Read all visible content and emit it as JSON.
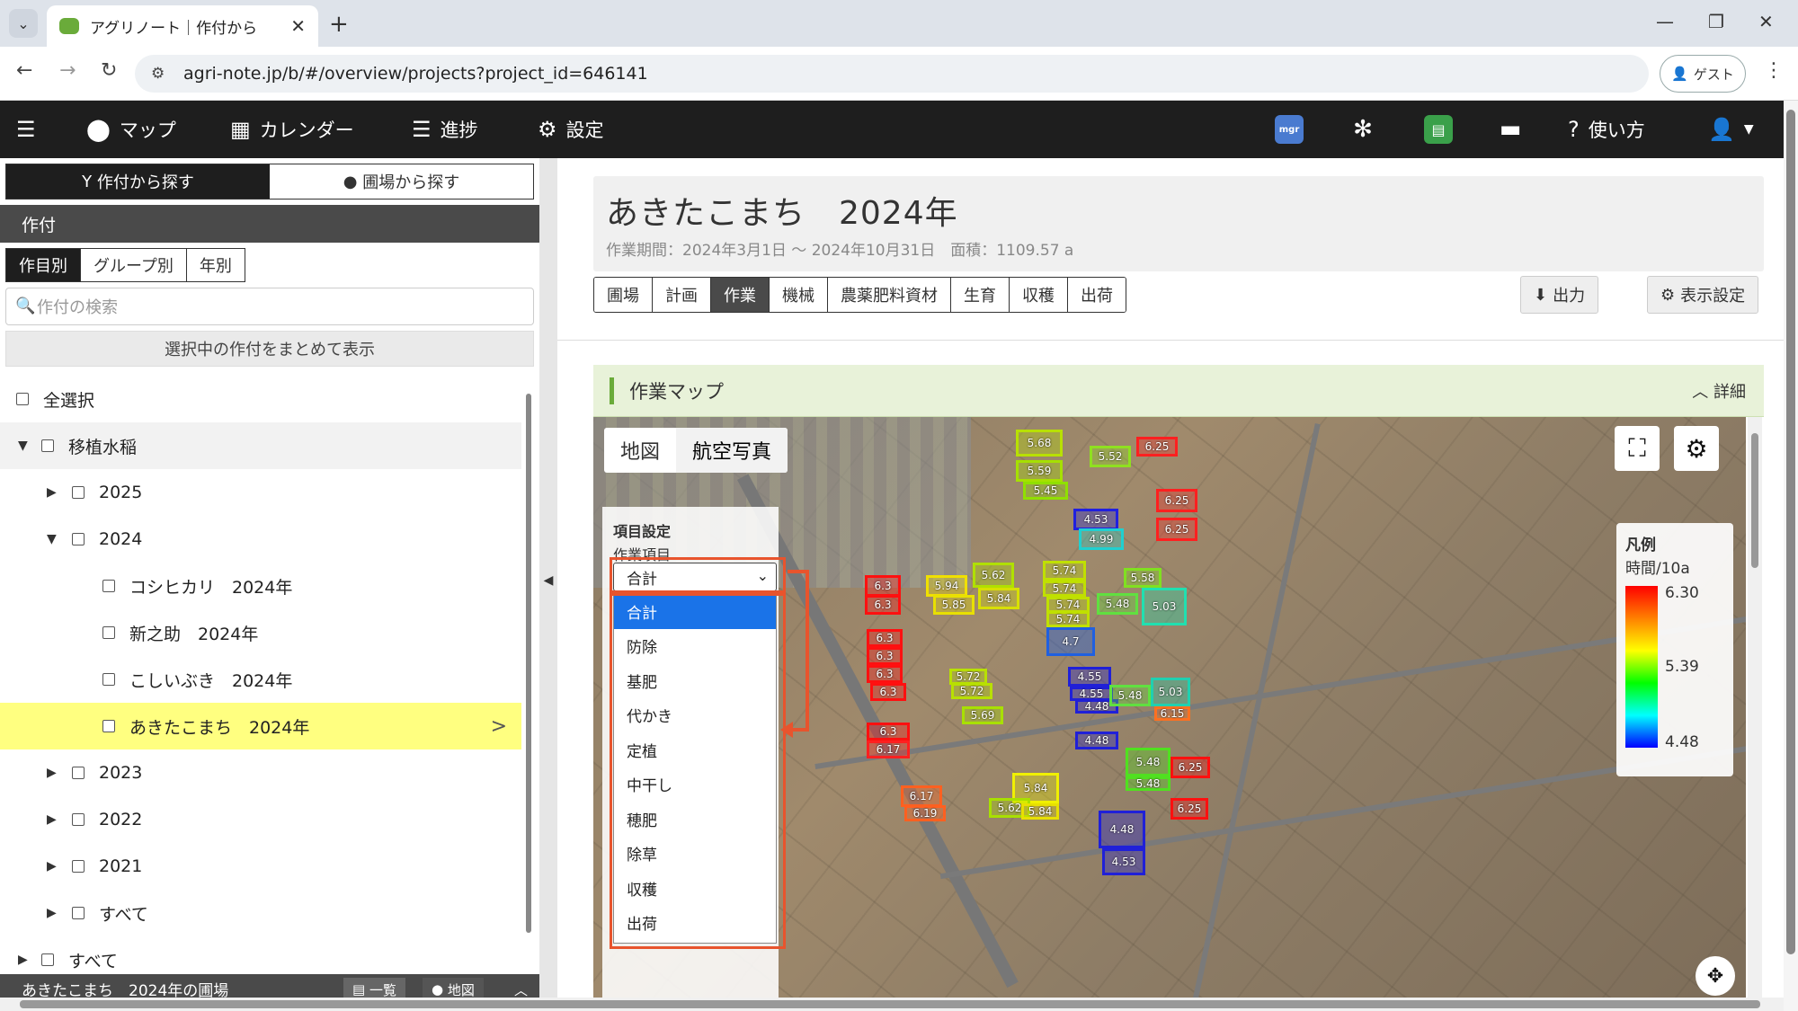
{
  "browser": {
    "tab_title": "アグリノート｜作付から",
    "url": "agri-note.jp/b/#/overview/projects?project_id=646141",
    "guest_label": "ゲスト"
  },
  "appbar": {
    "map": "マップ",
    "calendar": "カレンダー",
    "progress": "進捗",
    "settings": "設定",
    "help": "使い方",
    "mgr_badge": "mgr"
  },
  "left": {
    "tab_crop": "作付から探す",
    "tab_field": "圃場から探す",
    "section": "作付",
    "filter_item": "作目別",
    "filter_group": "グループ別",
    "filter_year": "年別",
    "search_placeholder": "作付の検索",
    "bulk_button": "選択中の作付をまとめて表示",
    "tree": [
      {
        "label": "全選択"
      },
      {
        "label": "移植水稲"
      },
      {
        "label": "2025"
      },
      {
        "label": "2024"
      },
      {
        "label": "コシヒカリ　2024年"
      },
      {
        "label": "新之助　2024年"
      },
      {
        "label": "こしいぶき　2024年"
      },
      {
        "label": "あきたこまち　2024年"
      },
      {
        "label": "2023"
      },
      {
        "label": "2022"
      },
      {
        "label": "2021"
      },
      {
        "label": "すべて"
      },
      {
        "label": "すべて"
      }
    ],
    "bottom_title": "あきたこまち　2024年の圃場",
    "bottom_list": "一覧",
    "bottom_map": "地図"
  },
  "main": {
    "title": "あきたこまち　2024年",
    "meta": "作業期間：2024年3月1日 〜 2024年10月31日　面積：1109.57 a",
    "tabs": [
      "圃場",
      "計画",
      "作業",
      "機械",
      "農薬肥料資材",
      "生育",
      "収穫",
      "出荷"
    ],
    "output_button": "出力",
    "display_settings": "表示設定",
    "panel_title": "作業マップ",
    "panel_detail": "詳細"
  },
  "map": {
    "toggle_map": "地図",
    "toggle_aerial": "航空写真",
    "item_settings": "項目設定",
    "work_item_label": "作業項目",
    "selected": "合計",
    "options": [
      "合計",
      "防除",
      "基肥",
      "代かき",
      "定植",
      "中干し",
      "穂肥",
      "除草",
      "収穫",
      "出荷"
    ],
    "legend_title": "凡例",
    "legend_unit": "時間/10a",
    "legend_max": "6.30",
    "legend_mid": "5.39",
    "legend_min": "4.48",
    "fields": [
      "5.68",
      "5.59",
      "5.45",
      "5.52",
      "6.25",
      "6.25",
      "6.25",
      "4.53",
      "4.99",
      "6.3",
      "6.3",
      "5.94",
      "5.85",
      "5.62",
      "5.84",
      "5.74",
      "5.74",
      "5.74",
      "5.74",
      "5.58",
      "5.48",
      "5.03",
      "4.7",
      "6.3",
      "6.3",
      "6.3",
      "6.3",
      "5.72",
      "5.72",
      "5.69",
      "4.55",
      "4.55",
      "4.48",
      "5.48",
      "5.03",
      "6.15",
      "6.3",
      "6.17",
      "4.48",
      "5.48",
      "5.48",
      "6.25",
      "5.84",
      "5.62",
      "5.84",
      "6.17",
      "6.19",
      "6.25",
      "4.48",
      "4.53"
    ]
  },
  "colors": {
    "appbar": "#1e1e1e",
    "selected_row": "#ffff80",
    "accent_green": "#6aab3a",
    "annotation_red": "#e8542d",
    "option_selected": "#1a73e8"
  }
}
